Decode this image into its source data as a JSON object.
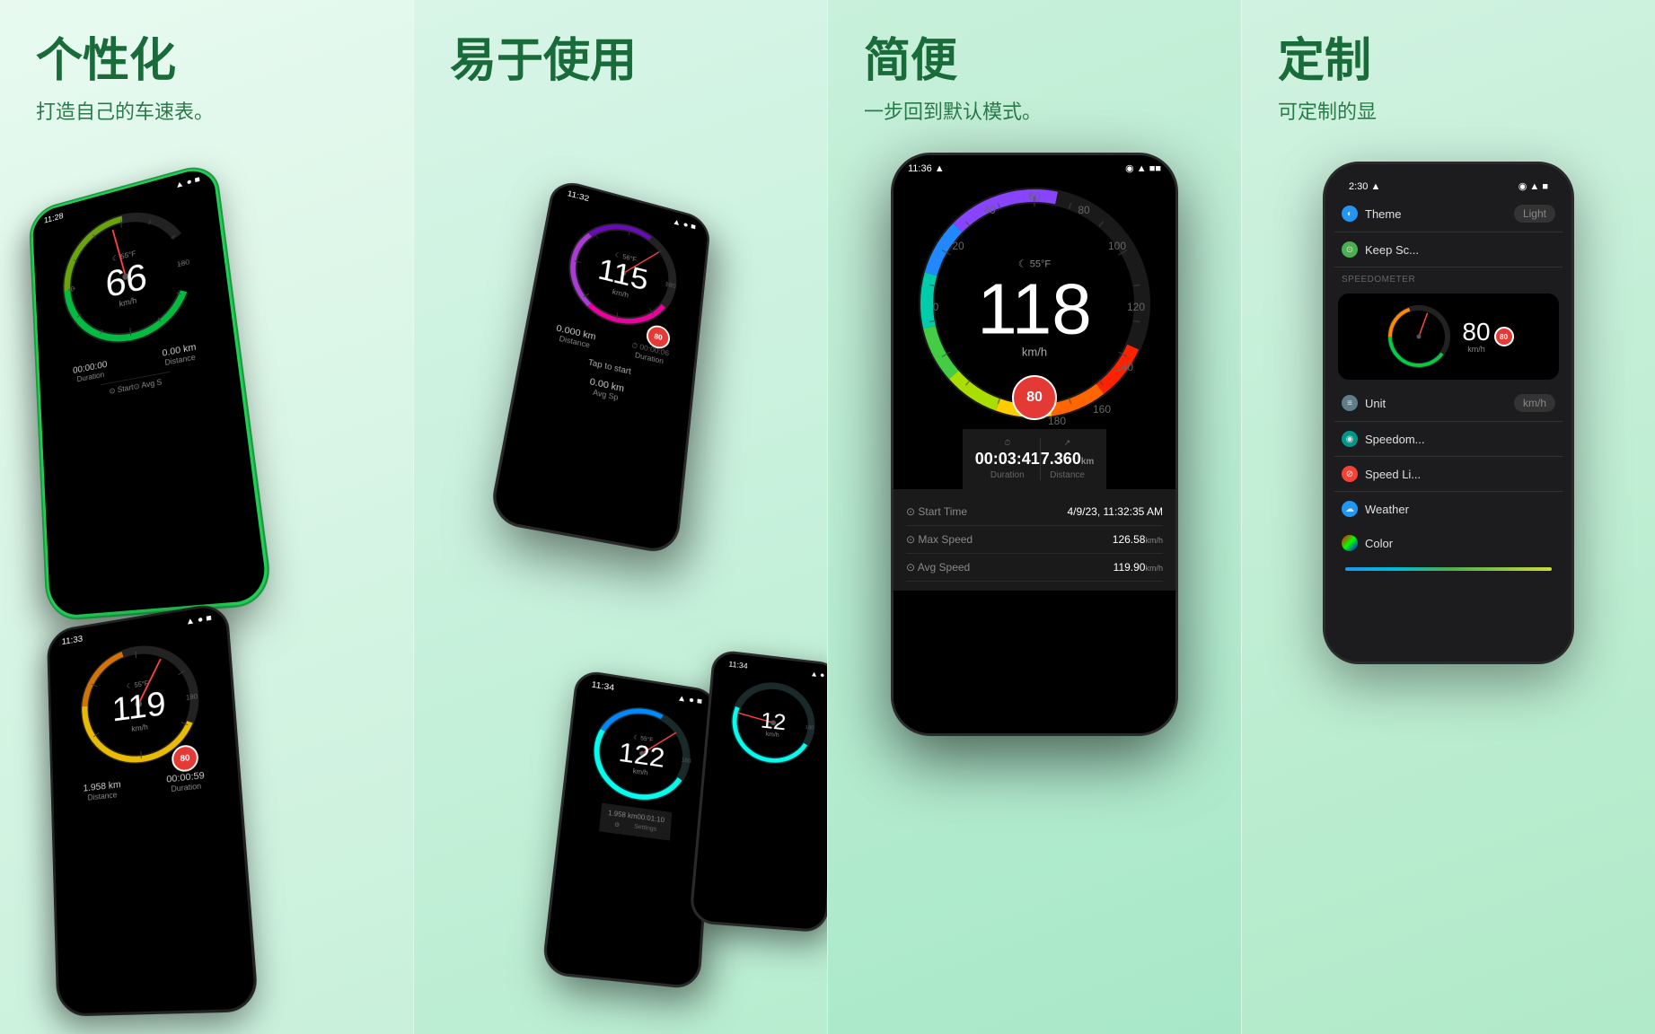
{
  "panels": [
    {
      "id": "panel1",
      "title": "个性化",
      "subtitle": "打造自己的车速表。",
      "bg_start": "#e8faf0",
      "bg_end": "#c8f0da",
      "phones": [
        {
          "id": "p1-top",
          "time": "11:28",
          "speed": "66",
          "unit": "km/h",
          "temp": "55°F",
          "limit": "N/A",
          "color": "green",
          "green_border": true
        },
        {
          "id": "p1-bottom",
          "time": "11:33",
          "speed": "119",
          "unit": "km/h",
          "temp": "55°F",
          "limit": "80",
          "color": "yellow"
        }
      ]
    },
    {
      "id": "panel2",
      "title": "易于使用",
      "subtitle": "",
      "phones": [
        {
          "id": "p2-main",
          "time": "11:32",
          "speed": "115",
          "unit": "km/h",
          "limit": "80",
          "color": "magenta",
          "distance": "0.000 km",
          "duration": "00:00:00"
        },
        {
          "id": "p2-mid",
          "time": "11:34",
          "speed": "122",
          "unit": "km/h",
          "color": "cyan"
        },
        {
          "id": "p2-far",
          "time": "11:34",
          "speed": "12",
          "unit": "km/h",
          "color": "cyan"
        }
      ]
    },
    {
      "id": "panel3",
      "title": "简便",
      "subtitle": "一步回到默认模式。",
      "phones": [
        {
          "id": "p3-main",
          "time": "11:36",
          "speed": "118",
          "unit": "km/h",
          "limit": "80",
          "temp": "55°F",
          "duration": "00:03:41",
          "distance": "7.360",
          "distance_unit": "km",
          "start_time": "4/9/23, 11:32:35 AM",
          "max_speed": "126.58",
          "avg_speed": "119.90",
          "color": "rainbow"
        }
      ]
    },
    {
      "id": "panel4",
      "title": "定制",
      "subtitle": "可定制的显",
      "phones": [
        {
          "id": "p4-main",
          "time": "2:30",
          "settings": {
            "theme_label": "Theme",
            "theme_value": "Light",
            "keep_screen": "Keep Sc...",
            "section_speedometer": "SPEEDOMETER",
            "unit_label": "Unit",
            "unit_value": "km/h",
            "speedometer_label": "Speedom...",
            "speed_limit_label": "Speed Li...",
            "weather_label": "Weather",
            "color_label": "Color"
          },
          "mini_speed": "80",
          "mini_limit": "80"
        }
      ]
    }
  ],
  "accent_color": "#1a6b3a",
  "subtitle_color": "#2a7a4a"
}
